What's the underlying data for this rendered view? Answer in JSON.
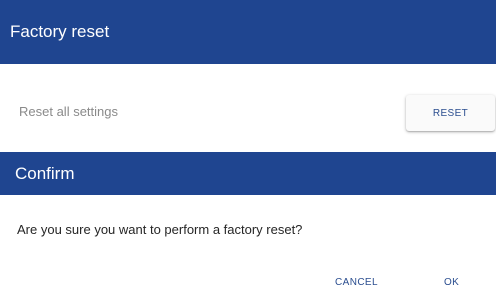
{
  "factory_reset": {
    "title": "Factory reset",
    "setting_label": "Reset all settings",
    "reset_button_label": "RESET"
  },
  "confirm_dialog": {
    "title": "Confirm",
    "message": "Are you sure you want to perform a factory reset?",
    "cancel_label": "CANCEL",
    "ok_label": "OK"
  },
  "colors": {
    "header_background": "#1f4590",
    "accent_text": "#2a4d8f"
  }
}
